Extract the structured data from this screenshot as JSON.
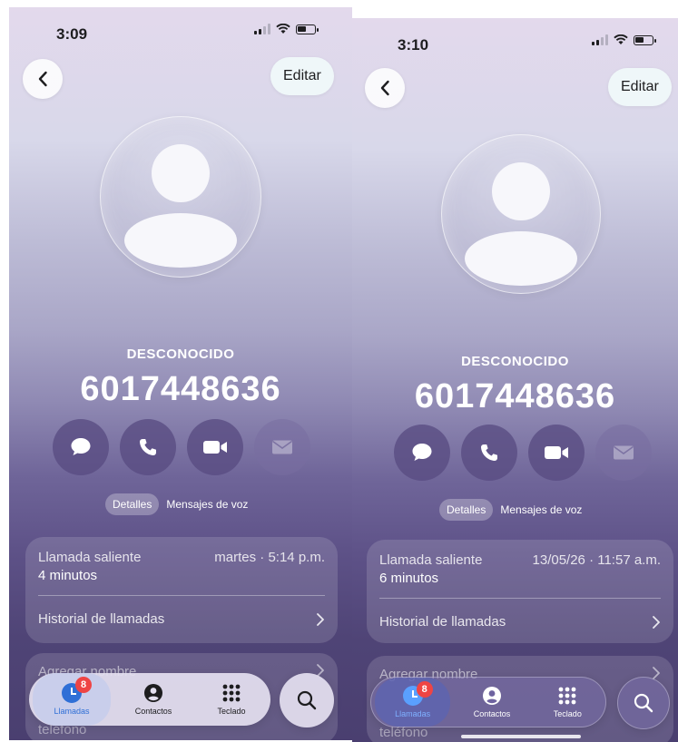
{
  "screens": [
    {
      "status_time": "3:09",
      "edit_label": "Editar",
      "contact_label": "DESCONOCIDO",
      "phone_number": "6017448636",
      "segments": {
        "details": "Detalles",
        "voicemail": "Mensajes de voz"
      },
      "call": {
        "type": "Llamada saliente",
        "date": "martes · 5:14 p.m.",
        "duration": "4 minutos"
      },
      "history_label": "Historial de llamadas",
      "add_name_label": "Agregar nombre",
      "phone_label": "teléfono",
      "tabs": {
        "calls": "Llamadas",
        "contacts": "Contactos",
        "keypad": "Teclado",
        "calls_badge": "8"
      }
    },
    {
      "status_time": "3:10",
      "edit_label": "Editar",
      "contact_label": "DESCONOCIDO",
      "phone_number": "6017448636",
      "segments": {
        "details": "Detalles",
        "voicemail": "Mensajes de voz"
      },
      "call": {
        "type": "Llamada saliente",
        "date": "13/05/26 · 11:57 a.m.",
        "duration": "6 minutos"
      },
      "history_label": "Historial de llamadas",
      "add_name_label": "Agregar nombre",
      "phone_label": "teléfono",
      "tabs": {
        "calls": "Llamadas",
        "contacts": "Contactos",
        "keypad": "Teclado",
        "calls_badge": "8"
      }
    }
  ],
  "icons": [
    "back-chevron-icon",
    "message-icon",
    "phone-icon",
    "video-icon",
    "mail-icon",
    "chevron-right-icon",
    "clock-icon",
    "person-icon",
    "keypad-icon",
    "search-icon",
    "signal-icon",
    "wifi-icon",
    "battery-icon"
  ],
  "colors": {
    "accent_blue": "#2f6fd6",
    "badge_red": "#ef4444",
    "button_purple": "#584c82"
  }
}
